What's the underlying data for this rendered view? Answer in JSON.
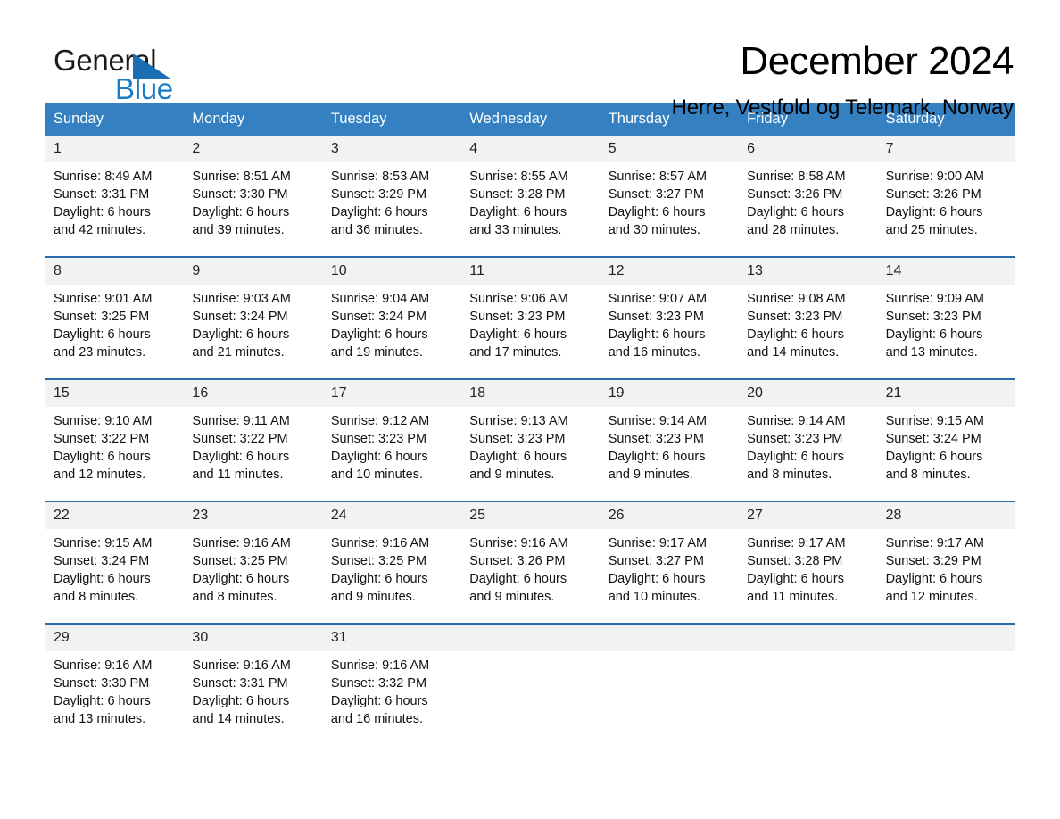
{
  "brand": {
    "name_dark": "General",
    "name_light": "Blue",
    "triangle_color": "#1a6fb4",
    "blue_color": "#1a7cc4"
  },
  "header": {
    "month_title": "December 2024",
    "location": "Herre, Vestfold og Telemark, Norway"
  },
  "theme": {
    "header_blue": "#3480c0",
    "divider_blue": "#2b6ca8",
    "daynum_band": "#f2f2f2"
  },
  "calendar": {
    "weekdays": [
      "Sunday",
      "Monday",
      "Tuesday",
      "Wednesday",
      "Thursday",
      "Friday",
      "Saturday"
    ],
    "weeks": [
      [
        {
          "day": "1",
          "l1": "Sunrise: 8:49 AM",
          "l2": "Sunset: 3:31 PM",
          "l3": "Daylight: 6 hours",
          "l4": "and 42 minutes."
        },
        {
          "day": "2",
          "l1": "Sunrise: 8:51 AM",
          "l2": "Sunset: 3:30 PM",
          "l3": "Daylight: 6 hours",
          "l4": "and 39 minutes."
        },
        {
          "day": "3",
          "l1": "Sunrise: 8:53 AM",
          "l2": "Sunset: 3:29 PM",
          "l3": "Daylight: 6 hours",
          "l4": "and 36 minutes."
        },
        {
          "day": "4",
          "l1": "Sunrise: 8:55 AM",
          "l2": "Sunset: 3:28 PM",
          "l3": "Daylight: 6 hours",
          "l4": "and 33 minutes."
        },
        {
          "day": "5",
          "l1": "Sunrise: 8:57 AM",
          "l2": "Sunset: 3:27 PM",
          "l3": "Daylight: 6 hours",
          "l4": "and 30 minutes."
        },
        {
          "day": "6",
          "l1": "Sunrise: 8:58 AM",
          "l2": "Sunset: 3:26 PM",
          "l3": "Daylight: 6 hours",
          "l4": "and 28 minutes."
        },
        {
          "day": "7",
          "l1": "Sunrise: 9:00 AM",
          "l2": "Sunset: 3:26 PM",
          "l3": "Daylight: 6 hours",
          "l4": "and 25 minutes."
        }
      ],
      [
        {
          "day": "8",
          "l1": "Sunrise: 9:01 AM",
          "l2": "Sunset: 3:25 PM",
          "l3": "Daylight: 6 hours",
          "l4": "and 23 minutes."
        },
        {
          "day": "9",
          "l1": "Sunrise: 9:03 AM",
          "l2": "Sunset: 3:24 PM",
          "l3": "Daylight: 6 hours",
          "l4": "and 21 minutes."
        },
        {
          "day": "10",
          "l1": "Sunrise: 9:04 AM",
          "l2": "Sunset: 3:24 PM",
          "l3": "Daylight: 6 hours",
          "l4": "and 19 minutes."
        },
        {
          "day": "11",
          "l1": "Sunrise: 9:06 AM",
          "l2": "Sunset: 3:23 PM",
          "l3": "Daylight: 6 hours",
          "l4": "and 17 minutes."
        },
        {
          "day": "12",
          "l1": "Sunrise: 9:07 AM",
          "l2": "Sunset: 3:23 PM",
          "l3": "Daylight: 6 hours",
          "l4": "and 16 minutes."
        },
        {
          "day": "13",
          "l1": "Sunrise: 9:08 AM",
          "l2": "Sunset: 3:23 PM",
          "l3": "Daylight: 6 hours",
          "l4": "and 14 minutes."
        },
        {
          "day": "14",
          "l1": "Sunrise: 9:09 AM",
          "l2": "Sunset: 3:23 PM",
          "l3": "Daylight: 6 hours",
          "l4": "and 13 minutes."
        }
      ],
      [
        {
          "day": "15",
          "l1": "Sunrise: 9:10 AM",
          "l2": "Sunset: 3:22 PM",
          "l3": "Daylight: 6 hours",
          "l4": "and 12 minutes."
        },
        {
          "day": "16",
          "l1": "Sunrise: 9:11 AM",
          "l2": "Sunset: 3:22 PM",
          "l3": "Daylight: 6 hours",
          "l4": "and 11 minutes."
        },
        {
          "day": "17",
          "l1": "Sunrise: 9:12 AM",
          "l2": "Sunset: 3:23 PM",
          "l3": "Daylight: 6 hours",
          "l4": "and 10 minutes."
        },
        {
          "day": "18",
          "l1": "Sunrise: 9:13 AM",
          "l2": "Sunset: 3:23 PM",
          "l3": "Daylight: 6 hours",
          "l4": "and 9 minutes."
        },
        {
          "day": "19",
          "l1": "Sunrise: 9:14 AM",
          "l2": "Sunset: 3:23 PM",
          "l3": "Daylight: 6 hours",
          "l4": "and 9 minutes."
        },
        {
          "day": "20",
          "l1": "Sunrise: 9:14 AM",
          "l2": "Sunset: 3:23 PM",
          "l3": "Daylight: 6 hours",
          "l4": "and 8 minutes."
        },
        {
          "day": "21",
          "l1": "Sunrise: 9:15 AM",
          "l2": "Sunset: 3:24 PM",
          "l3": "Daylight: 6 hours",
          "l4": "and 8 minutes."
        }
      ],
      [
        {
          "day": "22",
          "l1": "Sunrise: 9:15 AM",
          "l2": "Sunset: 3:24 PM",
          "l3": "Daylight: 6 hours",
          "l4": "and 8 minutes."
        },
        {
          "day": "23",
          "l1": "Sunrise: 9:16 AM",
          "l2": "Sunset: 3:25 PM",
          "l3": "Daylight: 6 hours",
          "l4": "and 8 minutes."
        },
        {
          "day": "24",
          "l1": "Sunrise: 9:16 AM",
          "l2": "Sunset: 3:25 PM",
          "l3": "Daylight: 6 hours",
          "l4": "and 9 minutes."
        },
        {
          "day": "25",
          "l1": "Sunrise: 9:16 AM",
          "l2": "Sunset: 3:26 PM",
          "l3": "Daylight: 6 hours",
          "l4": "and 9 minutes."
        },
        {
          "day": "26",
          "l1": "Sunrise: 9:17 AM",
          "l2": "Sunset: 3:27 PM",
          "l3": "Daylight: 6 hours",
          "l4": "and 10 minutes."
        },
        {
          "day": "27",
          "l1": "Sunrise: 9:17 AM",
          "l2": "Sunset: 3:28 PM",
          "l3": "Daylight: 6 hours",
          "l4": "and 11 minutes."
        },
        {
          "day": "28",
          "l1": "Sunrise: 9:17 AM",
          "l2": "Sunset: 3:29 PM",
          "l3": "Daylight: 6 hours",
          "l4": "and 12 minutes."
        }
      ],
      [
        {
          "day": "29",
          "l1": "Sunrise: 9:16 AM",
          "l2": "Sunset: 3:30 PM",
          "l3": "Daylight: 6 hours",
          "l4": "and 13 minutes."
        },
        {
          "day": "30",
          "l1": "Sunrise: 9:16 AM",
          "l2": "Sunset: 3:31 PM",
          "l3": "Daylight: 6 hours",
          "l4": "and 14 minutes."
        },
        {
          "day": "31",
          "l1": "Sunrise: 9:16 AM",
          "l2": "Sunset: 3:32 PM",
          "l3": "Daylight: 6 hours",
          "l4": "and 16 minutes."
        },
        {
          "day": "",
          "l1": "",
          "l2": "",
          "l3": "",
          "l4": ""
        },
        {
          "day": "",
          "l1": "",
          "l2": "",
          "l3": "",
          "l4": ""
        },
        {
          "day": "",
          "l1": "",
          "l2": "",
          "l3": "",
          "l4": ""
        },
        {
          "day": "",
          "l1": "",
          "l2": "",
          "l3": "",
          "l4": ""
        }
      ]
    ]
  }
}
